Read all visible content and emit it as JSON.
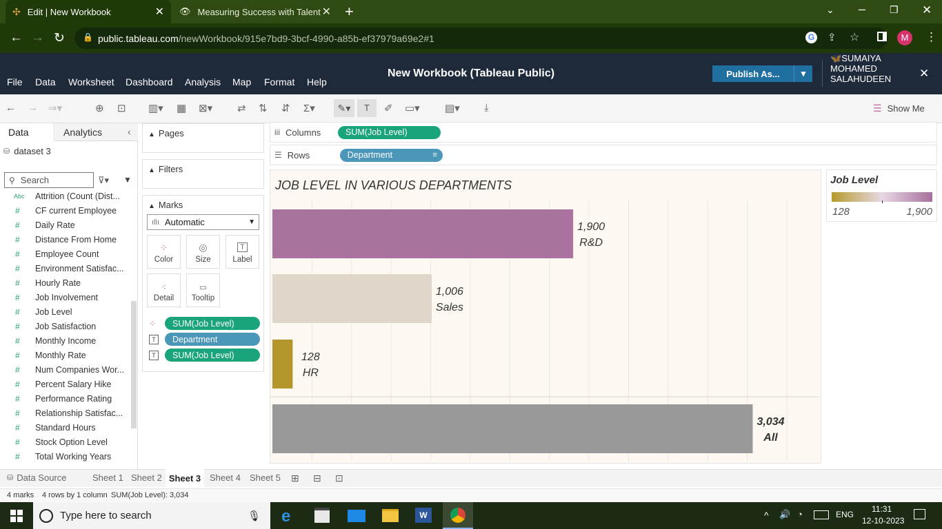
{
  "browser": {
    "tabs": [
      {
        "title": "Edit | New Workbook"
      },
      {
        "title": "Measuring Success with Talent M"
      }
    ],
    "url_host": "public.tableau.com",
    "url_path": "/newWorkbook/915e7bd9-3bcf-4990-a85b-ef37979a69e2#1",
    "profile_initial": "M"
  },
  "app": {
    "menu": [
      "File",
      "Data",
      "Worksheet",
      "Dashboard",
      "Analysis",
      "Map",
      "Format",
      "Help"
    ],
    "title": "New Workbook (Tableau Public)",
    "publish_label": "Publish As...",
    "user_name": "SUMAIYA MOHAMED SALAHUDEEN",
    "show_me": "Show Me"
  },
  "data_pane": {
    "tabs": [
      "Data",
      "Analytics"
    ],
    "datasource": "dataset 3",
    "search_placeholder": "Search",
    "fields": [
      {
        "type": "Abc",
        "name": "Attrition (Count (Dist..."
      },
      {
        "type": "#",
        "name": "CF current Employee"
      },
      {
        "type": "#",
        "name": "Daily Rate"
      },
      {
        "type": "#",
        "name": "Distance From Home"
      },
      {
        "type": "#",
        "name": "Employee Count"
      },
      {
        "type": "#",
        "name": "Environment Satisfac..."
      },
      {
        "type": "#",
        "name": "Hourly Rate"
      },
      {
        "type": "#",
        "name": "Job Involvement"
      },
      {
        "type": "#",
        "name": "Job Level"
      },
      {
        "type": "#",
        "name": "Job Satisfaction"
      },
      {
        "type": "#",
        "name": "Monthly Income"
      },
      {
        "type": "#",
        "name": "Monthly Rate"
      },
      {
        "type": "#",
        "name": "Num Companies Wor..."
      },
      {
        "type": "#",
        "name": "Percent Salary Hike"
      },
      {
        "type": "#",
        "name": "Performance Rating"
      },
      {
        "type": "#",
        "name": "Relationship Satisfac..."
      },
      {
        "type": "#",
        "name": "Standard Hours"
      },
      {
        "type": "#",
        "name": "Stock Option Level"
      },
      {
        "type": "#",
        "name": "Total Working Years"
      }
    ]
  },
  "cards": {
    "pages": "Pages",
    "filters": "Filters",
    "marks": "Marks",
    "mark_type": "Automatic",
    "mark_buttons": [
      "Color",
      "Size",
      "Label",
      "Detail",
      "Tooltip"
    ],
    "mark_pills": [
      {
        "icon": "color",
        "label": "SUM(Job Level)",
        "color": "green"
      },
      {
        "icon": "text",
        "label": "Department",
        "color": "blue"
      },
      {
        "icon": "text",
        "label": "SUM(Job Level)",
        "color": "green"
      }
    ]
  },
  "shelves": {
    "columns_label": "Columns",
    "columns_pill": "SUM(Job Level)",
    "rows_label": "Rows",
    "rows_pill": "Department"
  },
  "legend": {
    "title": "Job Level",
    "min": "128",
    "max": "1,900",
    "colors": [
      "#b59a2b",
      "#e8d8e4",
      "#a66f9d"
    ]
  },
  "chart_data": {
    "type": "bar",
    "orientation": "horizontal",
    "title": "JOB LEVEL IN VARIOUS DEPARTMENTS",
    "categories": [
      "R&D",
      "Sales",
      "HR",
      "All"
    ],
    "values": [
      1900,
      1006,
      128,
      3034
    ],
    "value_labels": [
      "1,900",
      "1,006",
      "128",
      "3,034"
    ],
    "colors": [
      "#aa739f",
      "#e0d7cb",
      "#b4962c",
      "#999999"
    ],
    "xlim": [
      0,
      3450
    ],
    "grid": true
  },
  "bottom": {
    "datasource_tab": "Data Source",
    "sheets": [
      "Sheet 1",
      "Sheet 2",
      "Sheet 3",
      "Sheet 4",
      "Sheet 5"
    ],
    "active_sheet": "Sheet 3",
    "status": {
      "marks": "4 marks",
      "rows": "4 rows by 1 column",
      "sum": "SUM(Job Level): 3,034"
    }
  },
  "taskbar": {
    "search_placeholder": "Type here to search",
    "lang": "ENG",
    "time": "11:31",
    "date": "12-10-2023"
  }
}
